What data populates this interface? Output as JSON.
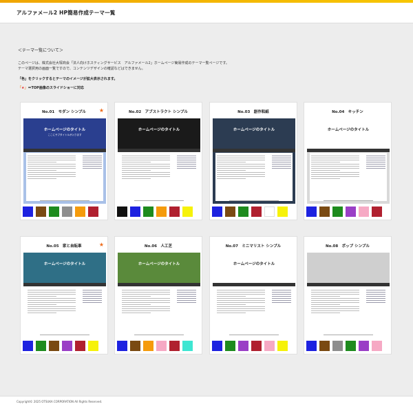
{
  "header": {
    "title": "アルファメール2 HP簡易作成テーマ一覧"
  },
  "intro": {
    "section_title": "＜テーマ一覧について＞",
    "line1": "このページは、株式会社大塚商会「法人向けホスティングサービス　アルファメール2」ホームページ簡易作成のテーマ一覧ページです。",
    "line2": "テーマ選択用の画面一覧ですので、コンテンツデザインの確認などはできません。",
    "bold_line": "「色」をクリックするとテーマのイメージが拡大表示されます。",
    "star_open": "「",
    "star_glyph": "★",
    "star_close": "」",
    "star_text": "＝TOP画像のスライドショーに対応"
  },
  "themes": [
    {
      "title": "No.01　モダン シンプル",
      "star": "★",
      "swatches": [
        "#1d22e0",
        "#7a4a12",
        "#1e8b1e",
        "#8e8e8e",
        "#f59b0c",
        "#b0202f"
      ]
    },
    {
      "title": "No.02　アブストラクト シンプル",
      "star": "",
      "swatches": [
        "#111111",
        "#1d22e0",
        "#1e8b1e",
        "#f59b0c",
        "#b0202f",
        "#f6f20a"
      ]
    },
    {
      "title": "No.03　創作和紙",
      "star": "",
      "swatches": [
        "#1d22e0",
        "#7a4a12",
        "#1e8b1e",
        "#b0202f",
        "#ffffff",
        "#f6f20a"
      ]
    },
    {
      "title": "No.04　キッチン",
      "star": "",
      "swatches": [
        "#1d22e0",
        "#7a4a12",
        "#1e8b1e",
        "#9a3fc6",
        "#f6a9c4",
        "#b0202f"
      ]
    },
    {
      "title": "No.05　家と自転車",
      "star": "★",
      "swatches": [
        "#1d22e0",
        "#1e8b1e",
        "#7a4a12",
        "#9a3fc6",
        "#b0202f",
        "#f6f20a"
      ]
    },
    {
      "title": "No.06　人工芝",
      "star": "",
      "swatches": [
        "#1d22e0",
        "#7a4a12",
        "#f59b0c",
        "#f6a9c4",
        "#b0202f",
        "#3ee6d2"
      ]
    },
    {
      "title": "No.07　ミニマリスト シンプル",
      "star": "",
      "swatches": [
        "#1d22e0",
        "#1e8b1e",
        "#9a3fc6",
        "#b0202f",
        "#f6a9c4",
        "#f6f20a"
      ]
    },
    {
      "title": "No.08　ポップ シンプル",
      "star": "",
      "swatches": [
        "#1d22e0",
        "#7a4a12",
        "#8e8e8e",
        "#1e8b1e",
        "#9a3fc6",
        "#f6a9c4"
      ]
    }
  ],
  "thumbs": [
    {
      "hero_bg": "#2a3f8f",
      "page_bg": "#a9c1e8",
      "title": "ホームページのタイトル",
      "sub": "ここにサブタイトルが入ります"
    },
    {
      "hero_bg": "#1a1a1a",
      "page_bg": "#ffffff",
      "title": "ホームページのタイトル",
      "sub": ""
    },
    {
      "hero_bg": "#2c3c52",
      "page_bg": "#2c3c52",
      "title": "ホームページのタイトル",
      "sub": ""
    },
    {
      "hero_bg": "#ffffff",
      "page_bg": "#d9d9d9",
      "title": "ホームページのタイトル",
      "sub": ""
    },
    {
      "hero_bg": "#2f6f86",
      "page_bg": "#ffffff",
      "title": "ホームページのタイトル",
      "sub": ""
    },
    {
      "hero_bg": "#5a8a3b",
      "page_bg": "#ffffff",
      "title": "ホームページのタイトル",
      "sub": ""
    },
    {
      "hero_bg": "#ffffff",
      "page_bg": "#ffffff",
      "title": "ホームページのタイトル",
      "sub": ""
    },
    {
      "hero_bg": "#cfcfcf",
      "page_bg": "#ffffff",
      "title": "",
      "sub": ""
    }
  ],
  "footer": {
    "copyright": "Copyright© 2025 OTSUKA CORPORATION All Rights Reserved."
  }
}
